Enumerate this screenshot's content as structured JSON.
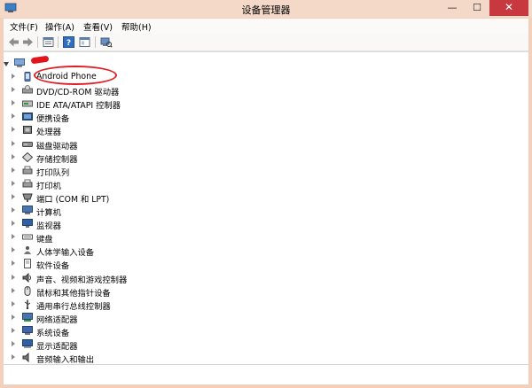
{
  "window": {
    "title": "设备管理器",
    "controls": {
      "minimize": "—",
      "maximize": "☐",
      "close": "✕"
    }
  },
  "menu": [
    "文件(F)",
    "操作(A)",
    "查看(V)",
    "帮助(H)"
  ],
  "toolbar": {
    "buttons": [
      "back-icon",
      "forward-icon",
      "properties-icon",
      "help-icon",
      "show-hide-icon",
      "scan-hardware-icon"
    ]
  },
  "tree": {
    "root_label": "",
    "items": [
      {
        "label": "Android Phone",
        "icon": "phone-icon"
      },
      {
        "label": "DVD/CD-ROM 驱动器",
        "icon": "dvd-icon"
      },
      {
        "label": "IDE ATA/ATAPI 控制器",
        "icon": "ide-controller-icon"
      },
      {
        "label": "便携设备",
        "icon": "portable-device-icon"
      },
      {
        "label": "处理器",
        "icon": "processor-icon"
      },
      {
        "label": "磁盘驱动器",
        "icon": "disk-drive-icon"
      },
      {
        "label": "存储控制器",
        "icon": "storage-controller-icon"
      },
      {
        "label": "打印队列",
        "icon": "print-queue-icon"
      },
      {
        "label": "打印机",
        "icon": "printer-icon"
      },
      {
        "label": "端口 (COM 和 LPT)",
        "icon": "port-icon"
      },
      {
        "label": "计算机",
        "icon": "computer-icon"
      },
      {
        "label": "监视器",
        "icon": "monitor-icon"
      },
      {
        "label": "键盘",
        "icon": "keyboard-icon"
      },
      {
        "label": "人体学输入设备",
        "icon": "hid-icon"
      },
      {
        "label": "软件设备",
        "icon": "software-device-icon"
      },
      {
        "label": "声音、视频和游戏控制器",
        "icon": "sound-icon"
      },
      {
        "label": "鼠标和其他指针设备",
        "icon": "mouse-icon"
      },
      {
        "label": "通用串行总线控制器",
        "icon": "usb-icon"
      },
      {
        "label": "网络适配器",
        "icon": "network-adapter-icon"
      },
      {
        "label": "系统设备",
        "icon": "system-device-icon"
      },
      {
        "label": "显示适配器",
        "icon": "display-adapter-icon"
      },
      {
        "label": "音频输入和输出",
        "icon": "audio-io-icon"
      }
    ]
  },
  "colors": {
    "title_bar": "#f5d9c8",
    "close_button": "#c8383f",
    "annotation": "#e01c24"
  }
}
